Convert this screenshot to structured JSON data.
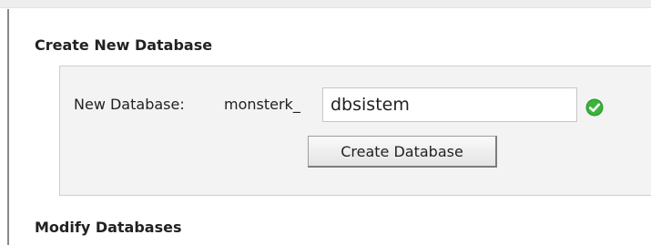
{
  "create_section": {
    "title": "Create New Database",
    "field_label": "New Database:",
    "prefix": "monsterk_",
    "input_value": "dbsistem",
    "status_icon": "check-circle-icon",
    "status_color": "#2e9e2e",
    "button_label": "Create Database"
  },
  "modify_section": {
    "title": "Modify Databases"
  }
}
